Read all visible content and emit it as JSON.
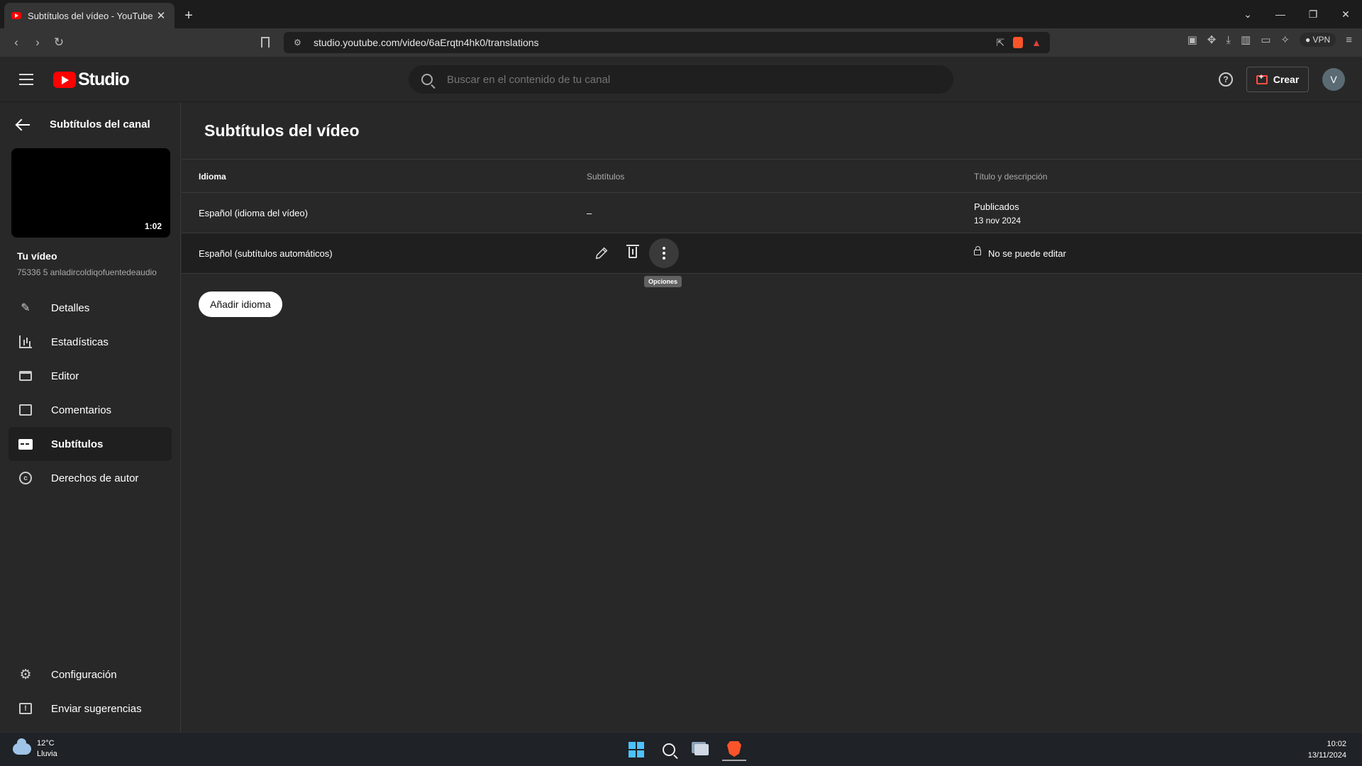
{
  "browser": {
    "tab_title": "Subtítulos del vídeo - YouTube Studio",
    "tab_close": "✕",
    "new_tab": "+",
    "url": "studio.youtube.com/video/6aErqtn4hk0/translations",
    "vpn_label": "VPN",
    "window_controls": [
      "⌄",
      "—",
      "❐",
      "✕"
    ]
  },
  "header": {
    "brand": "Studio",
    "search_placeholder": "Buscar en el contenido de tu canal",
    "help": "?",
    "create_label": "Crear",
    "avatar_letter": "V"
  },
  "sidebar": {
    "back_title": "Subtítulos del canal",
    "video_duration": "1:02",
    "video_title": "Tu vídeo",
    "video_subtitle": "75336 5 anladircoldiqofuentedeaudio",
    "items": [
      {
        "label": "Detalles",
        "icon": "pencil-icon"
      },
      {
        "label": "Estadísticas",
        "icon": "stats-icon"
      },
      {
        "label": "Editor",
        "icon": "editor-icon"
      },
      {
        "label": "Comentarios",
        "icon": "comments-icon"
      },
      {
        "label": "Subtítulos",
        "icon": "subtitles-icon",
        "active": true
      },
      {
        "label": "Derechos de autor",
        "icon": "copyright-icon"
      }
    ],
    "bottom_items": [
      {
        "label": "Configuración",
        "icon": "gear-icon"
      },
      {
        "label": "Enviar sugerencias",
        "icon": "feedback-icon"
      }
    ]
  },
  "main": {
    "title": "Subtítulos del vídeo",
    "columns": [
      "Idioma",
      "Subtítulos",
      "Título y descripción"
    ],
    "rows": [
      {
        "language": "Español (idioma del vídeo)",
        "subtitles": "–",
        "title_status": "Publicados",
        "title_date": "13 nov 2024"
      },
      {
        "language": "Español (subtítulos automáticos)",
        "title_status": "No se puede editar"
      }
    ],
    "tooltip": "Opciones",
    "add_language": "Añadir idioma"
  },
  "taskbar": {
    "temperature": "12°C",
    "weather": "Lluvia",
    "time": "10:02",
    "date": "13/11/2024"
  }
}
